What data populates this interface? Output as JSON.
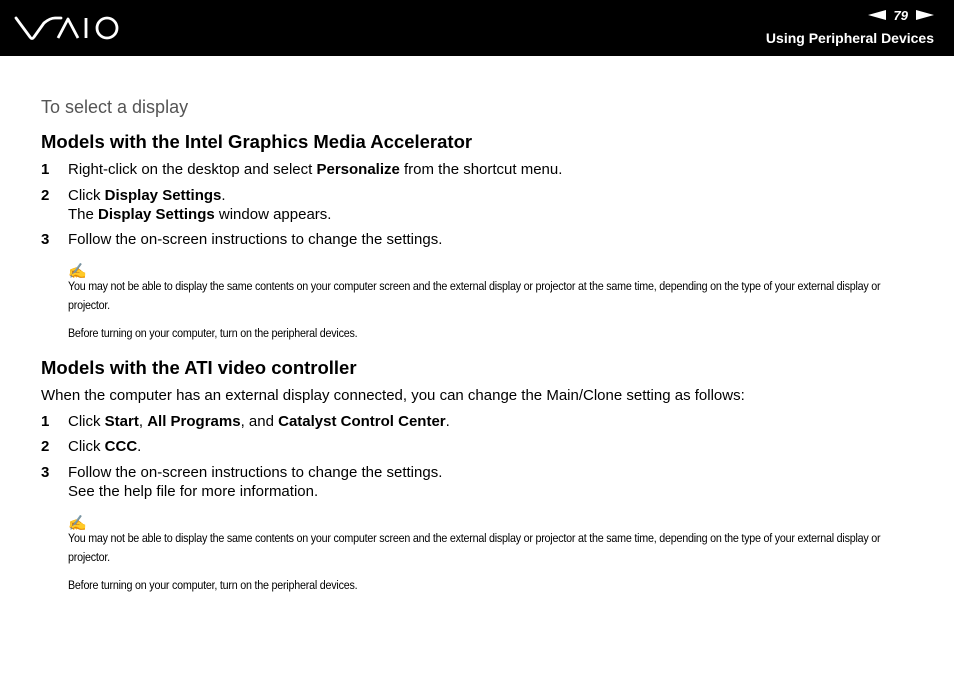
{
  "header": {
    "page_number": "79",
    "section_title": "Using Peripheral Devices",
    "logo_icon": "vaio-logo-icon",
    "prev_icon": "arrow-left-icon",
    "next_icon": "arrow-right-icon"
  },
  "content": {
    "subtitle": "To select a display",
    "intel": {
      "heading": "Models with the Intel Graphics Media Accelerator",
      "steps": [
        {
          "num": "1",
          "a": "Right-click on the desktop and select ",
          "b": "Personalize",
          "c": " from the shortcut menu."
        },
        {
          "num": "2",
          "a": "Click ",
          "b": "Display Settings",
          "c": ".",
          "line2_a": "The ",
          "line2_b": "Display Settings",
          "line2_c": " window appears."
        },
        {
          "num": "3",
          "a": "Follow the on-screen instructions to change the settings."
        }
      ],
      "note_icon": "✍",
      "note1": "You may not be able to display the same contents on your computer screen and the external display or projector at the same time, depending on the type of your external display or projector.",
      "note2": "Before turning on your computer, turn on the peripheral devices."
    },
    "ati": {
      "heading": "Models with the ATI video controller",
      "intro": "When the computer has an external display connected, you can change the Main/Clone setting as follows:",
      "steps": [
        {
          "num": "1",
          "a": "Click ",
          "b1": "Start",
          "s1": ", ",
          "b2": "All Programs",
          "s2": ", and ",
          "b3": "Catalyst Control Center",
          "s3": "."
        },
        {
          "num": "2",
          "a": "Click ",
          "b": "CCC",
          "c": "."
        },
        {
          "num": "3",
          "a": "Follow the on-screen instructions to change the settings.",
          "line2": "See the help file for more information."
        }
      ],
      "note_icon": "✍",
      "note1": "You may not be able to display the same contents on your computer screen and the external display or projector at the same time, depending on the type of your external display or projector.",
      "note2": "Before turning on your computer, turn on the peripheral devices."
    }
  }
}
